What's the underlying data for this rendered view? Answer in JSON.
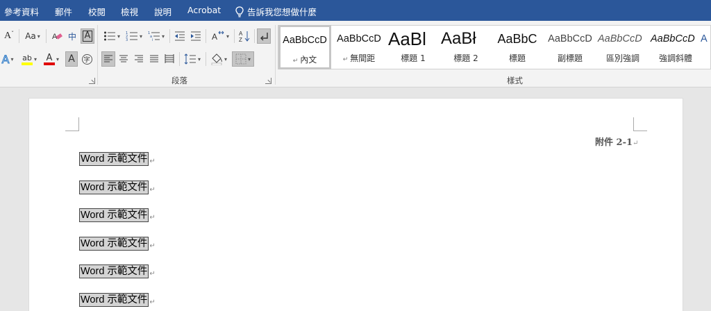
{
  "menu": {
    "items": [
      "參考資料",
      "郵件",
      "校閱",
      "檢視",
      "說明",
      "Acrobat"
    ],
    "tell_me": "告訴我您想做什麼"
  },
  "ribbon": {
    "font_group": {
      "font_size_grow": "A",
      "change_case": "Aa",
      "chinese_ruby": "中",
      "char_border": "A",
      "font_color_letter": "A",
      "highlight_letter": "ab",
      "shading_letter": "A",
      "text_effects_letter": "A"
    },
    "paragraph_group": {
      "label": "段落"
    },
    "styles_group": {
      "label": "樣式"
    }
  },
  "styles": [
    {
      "preview": "AaBbCcD",
      "name": "內文",
      "has_mark": true
    },
    {
      "preview": "AaBbCcD",
      "name": "無間距",
      "has_mark": true
    },
    {
      "preview": "AaBl",
      "name": "標題 1",
      "has_mark": false
    },
    {
      "preview": "AaBł",
      "name": "標題 2",
      "has_mark": false
    },
    {
      "preview": "AaBbC",
      "name": "標題",
      "has_mark": false
    },
    {
      "preview": "AaBbCcD",
      "name": "副標題",
      "has_mark": false
    },
    {
      "preview": "AaBbCcD",
      "name": "區別強調",
      "has_mark": false
    },
    {
      "preview": "AaBbCcD",
      "name": "強調斜體",
      "has_mark": false
    }
  ],
  "document": {
    "attachment_label": "附件 2-1",
    "paragraph_mark": "↵",
    "lines": [
      "Word 示範文件",
      "Word 示範文件",
      "Word 示範文件",
      "Word 示範文件",
      "Word 示範文件",
      "Word 示範文件"
    ]
  }
}
